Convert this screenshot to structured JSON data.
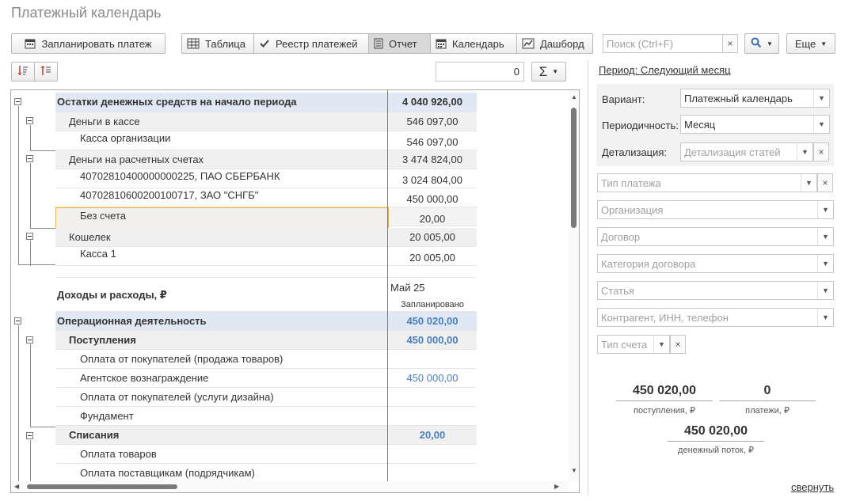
{
  "window": {
    "title": "Платежный календарь"
  },
  "toolbar": {
    "plan_payment": "Запланировать платеж",
    "views": [
      "Таблица",
      "Реестр платежей",
      "Отчет",
      "Календарь",
      "Дашборд"
    ],
    "active_view": "Отчет",
    "search_placeholder": "Поиск (Ctrl+F)",
    "more": "Еще"
  },
  "report_toolbar": {
    "number_value": "0",
    "sigma": "Σ"
  },
  "report": {
    "rows": [
      {
        "label": "Остатки денежных средств на начало периода",
        "amount": "4 040 926,00"
      },
      {
        "label": "Деньги в кассе",
        "amount": "546 097,00"
      },
      {
        "label": "Касса организации",
        "amount": "546 097,00"
      },
      {
        "label": "Деньги на расчетных счетах",
        "amount": "3 474 824,00"
      },
      {
        "label": "40702810400000000225, ПАО СБЕРБАНК",
        "amount": "3 024 804,00"
      },
      {
        "label": "40702810600200100717, ЗАО \"СНГБ\"",
        "amount": "450 000,00"
      },
      {
        "label": "Без счета",
        "amount": "20,00"
      },
      {
        "label": "Кошелек",
        "amount": "20 005,00"
      },
      {
        "label": "Касса 1",
        "amount": "20 005,00"
      }
    ],
    "income_header": "Доходы и расходы, ₽",
    "month": "Май 25",
    "planned": "Запланировано",
    "rows2": [
      {
        "label": "Операционная деятельность",
        "amount": "450 020,00"
      },
      {
        "label": "Поступления",
        "amount": "450 000,00"
      },
      {
        "label": "Оплата от покупателей (продажа товаров)",
        "amount": ""
      },
      {
        "label": "Агентское вознаграждение",
        "amount": "450 000,00"
      },
      {
        "label": "Оплата от покупателей (услуги дизайна)",
        "amount": ""
      },
      {
        "label": "Фундамент",
        "amount": ""
      },
      {
        "label": "Списания",
        "amount": "20,00"
      },
      {
        "label": "Оплата товаров",
        "amount": ""
      },
      {
        "label": "Оплата поставщикам (подрядчикам)",
        "amount": ""
      }
    ]
  },
  "settings": {
    "period_link": "Период: Следующий месяц",
    "variant_label": "Вариант:",
    "variant_value": "Платежный календарь",
    "periodicity_label": "Периодичность:",
    "periodicity_value": "Месяц",
    "detail_label": "Детализация:",
    "detail_placeholder": "Детализация статей",
    "filters": [
      "Тип платежа",
      "Организация",
      "Договор",
      "Категория договора",
      "Статья",
      "Контрагент, ИНН, телефон",
      "Тип счета"
    ]
  },
  "summary": {
    "receipts_value": "450 020,00",
    "receipts_label": "поступления, ₽",
    "payments_value": "0",
    "payments_label": "платежи, ₽",
    "flow_value": "450 020,00",
    "flow_label": "денежный поток, ₽",
    "collapse": "свернуть"
  },
  "colors": {
    "accent_blue": "#4a7ec0",
    "row_blue": "#dfe8f3",
    "highlight": "#f2b800"
  }
}
